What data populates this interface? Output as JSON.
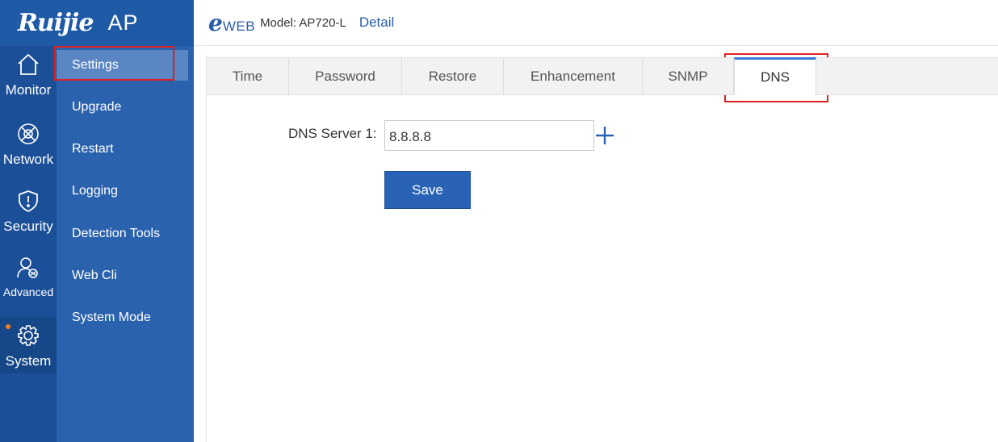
{
  "brand": {
    "logo": "Ruijie",
    "product": "AP"
  },
  "header": {
    "logo_e": "e",
    "logo_web": "WEB",
    "model": "Model: AP720-L",
    "detail_link": "Detail"
  },
  "rail": {
    "items": [
      {
        "label": "Monitor",
        "icon": "home-icon"
      },
      {
        "label": "Network",
        "icon": "globe-icon"
      },
      {
        "label": "Security",
        "icon": "shield-icon"
      },
      {
        "label": "Advanced",
        "icon": "users-icon"
      },
      {
        "label": "System",
        "icon": "gear-icon",
        "active": true
      }
    ]
  },
  "submenu": {
    "items": [
      {
        "label": "Settings",
        "active": true
      },
      {
        "label": "Upgrade"
      },
      {
        "label": "Restart"
      },
      {
        "label": "Logging"
      },
      {
        "label": "Detection Tools"
      },
      {
        "label": "Web Cli"
      },
      {
        "label": "System Mode"
      }
    ]
  },
  "tabs": [
    {
      "label": "Time"
    },
    {
      "label": "Password"
    },
    {
      "label": "Restore"
    },
    {
      "label": "Enhancement"
    },
    {
      "label": "SNMP"
    },
    {
      "label": "DNS",
      "active": true
    }
  ],
  "form": {
    "dns_label": "DNS Server 1:",
    "dns_value": "8.8.8.8",
    "save_label": "Save"
  },
  "colors": {
    "brand_blue": "#1f5aa6",
    "accent": "#3b78d0",
    "highlight": "#e02020"
  }
}
